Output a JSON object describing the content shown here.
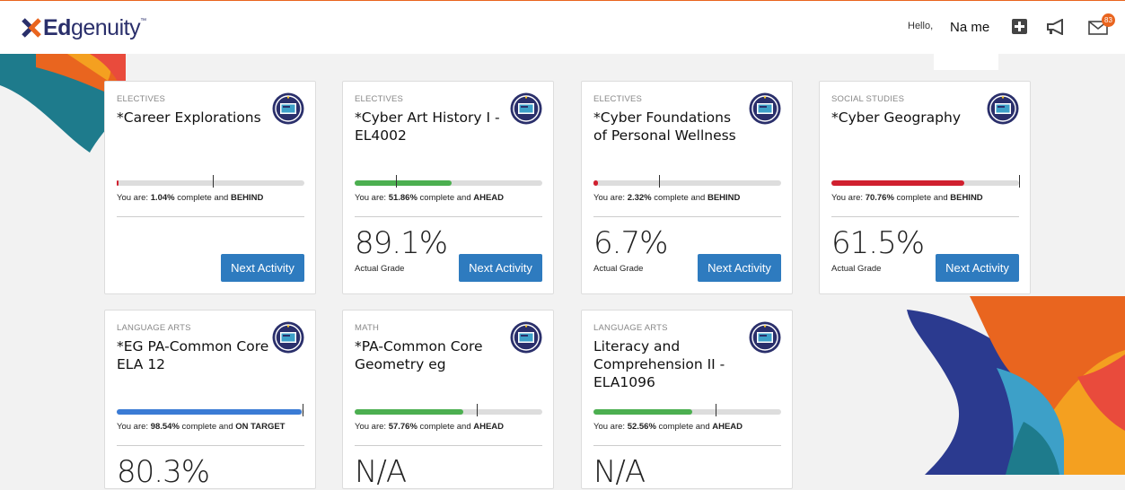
{
  "header": {
    "logo": {
      "prefix": "Ed",
      "suffix": "genuity",
      "tm": "™"
    },
    "greeting": "Hello,",
    "user_name": "Na me",
    "icons": [
      "plus-square-icon",
      "megaphone-icon",
      "mail-icon"
    ],
    "notification_count": "83"
  },
  "colors": {
    "accent": "#e9651f",
    "button": "#2e7bbf",
    "ahead": "#4caf50",
    "behind": "#d0202f",
    "on_target": "#3a7bd5"
  },
  "cards": [
    {
      "category": "ELECTIVES",
      "title": "*Career Explorations",
      "status_prefix": "You are: ",
      "percent": "1.04%",
      "status_mid": " complete and ",
      "status": "BEHIND",
      "progress": 1.04,
      "target": 51,
      "grade": "",
      "grade_label": "",
      "button": "Next Activity"
    },
    {
      "category": "ELECTIVES",
      "title": "*Cyber Art History I - EL4002",
      "status_prefix": "You are: ",
      "percent": "51.86%",
      "status_mid": " complete and ",
      "status": "AHEAD",
      "progress": 51.86,
      "target": 22,
      "grade": "89.1%",
      "grade_label": "Actual Grade",
      "button": "Next Activity"
    },
    {
      "category": "ELECTIVES",
      "title": "*Cyber Foundations of Personal Wellness",
      "status_prefix": "You are: ",
      "percent": "2.32%",
      "status_mid": " complete and ",
      "status": "BEHIND",
      "progress": 2.32,
      "target": 35,
      "grade": "6.7%",
      "grade_label": "Actual Grade",
      "button": "Next Activity"
    },
    {
      "category": "SOCIAL STUDIES",
      "title": "*Cyber Geography",
      "status_prefix": "You are: ",
      "percent": "70.76%",
      "status_mid": " complete and ",
      "status": "BEHIND",
      "progress": 70.76,
      "target": 100,
      "grade": "61.5%",
      "grade_label": "Actual Grade",
      "button": "Next Activity"
    },
    {
      "category": "LANGUAGE ARTS",
      "title": "*EG PA-Common Core ELA 12",
      "status_prefix": "You are: ",
      "percent": "98.54%",
      "status_mid": " complete and ",
      "status": "ON TARGET",
      "progress": 98.54,
      "target": 99,
      "grade": "80.3%",
      "grade_label": "",
      "button": ""
    },
    {
      "category": "MATH",
      "title": "*PA-Common Core Geometry eg",
      "status_prefix": "You are: ",
      "percent": "57.76%",
      "status_mid": " complete and ",
      "status": "AHEAD",
      "progress": 57.76,
      "target": 65,
      "grade": "N/A",
      "grade_label": "",
      "button": ""
    },
    {
      "category": "LANGUAGE ARTS",
      "title": "Literacy and Comprehension II - ELA1096",
      "status_prefix": "You are: ",
      "percent": "52.56%",
      "status_mid": " complete and ",
      "status": "AHEAD",
      "progress": 52.56,
      "target": 65,
      "grade": "N/A",
      "grade_label": "",
      "button": ""
    }
  ]
}
